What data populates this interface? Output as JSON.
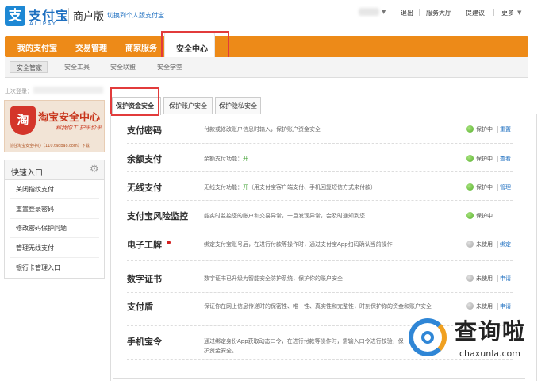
{
  "header": {
    "logo_mark": "支",
    "logo_cn": "支付宝",
    "logo_en": "ALIPAY",
    "title": "商户版",
    "switch_link": "切换到个人版支付宝",
    "links": [
      "退出",
      "服务大厅",
      "提建议",
      "更多"
    ]
  },
  "nav": {
    "items": [
      "我的支付宝",
      "交易管理",
      "商家服务",
      "安全中心"
    ],
    "active": "安全中心"
  },
  "subnav": {
    "items": [
      "安全管家",
      "安全工具",
      "安全联盟",
      "安全学堂"
    ],
    "active": "安全管家"
  },
  "sidebar": {
    "last_login_label": "上次登录：",
    "banner": {
      "icon_text": "淘",
      "title": "淘宝安全中心",
      "slogan": "和我你工  护平价平",
      "footer": "前往淘宝安全中心（110.taobao.com）下载"
    },
    "quick": {
      "title": "快速入口",
      "items": [
        "关闭指纹支付",
        "重置登录密码",
        "修改密码保护问题",
        "管理无线支付",
        "银行卡管理入口"
      ]
    }
  },
  "tabs": [
    "保护资金安全",
    "保护账户安全",
    "保护隐私安全"
  ],
  "rows": [
    {
      "title": "支付密码",
      "desc": "付款或修改账户信息时输入，保护账户资金安全",
      "status": "保护中",
      "state": "on",
      "actions": [
        "重置"
      ]
    },
    {
      "title": "余额支付",
      "desc": "余额支付功能：",
      "desc_on": "开",
      "desc_after": "",
      "status": "保护中",
      "state": "on",
      "actions": [
        "查看"
      ]
    },
    {
      "title": "无线支付",
      "desc": "无线支付功能：",
      "desc_on": "开",
      "desc_after": "（用支付宝客户端支付、手机回复短信方式来付款）",
      "status": "保护中",
      "state": "on",
      "actions": [
        "管理"
      ]
    },
    {
      "title": "支付宝风险监控",
      "desc": "能实时监控您的账户和交易异常，一旦发现异常，会及时通知到您",
      "status": "保护中",
      "state": "on",
      "actions": []
    },
    {
      "title": "电子工牌",
      "desc": "绑定支付宝账号后，在进行付款等操作时，通过支付宝App扫码确认当前操作",
      "status": "未使用",
      "state": "off",
      "actions": [
        "绑定"
      ]
    },
    {
      "title": "数字证书",
      "desc": "数字证书已升级为智能安全防护系统，保护你的账户安全",
      "status": "未使用",
      "state": "off",
      "actions": [
        "申请"
      ]
    },
    {
      "title": "支付盾",
      "desc": "保证你在网上信息传递时的保密性、唯一性、真实性和完整性，时刻保护你的资金和账户安全",
      "status": "未使用",
      "state": "off",
      "actions": [
        "申请"
      ]
    },
    {
      "title": "手机宝令",
      "desc": "通过绑定身份App获取动态口令，在进行付款等操作时，需输入口令进行校验，保护资金安全。",
      "status": "",
      "state": "none",
      "actions": []
    }
  ],
  "watermark": {
    "text": "查询啦",
    "url": "chaxunla.com"
  },
  "colors": {
    "nav_orange": "#ed8a18",
    "link_blue": "#1e6fc0",
    "protect_green": "#57b02d",
    "highlight_red": "#e23b3b"
  }
}
